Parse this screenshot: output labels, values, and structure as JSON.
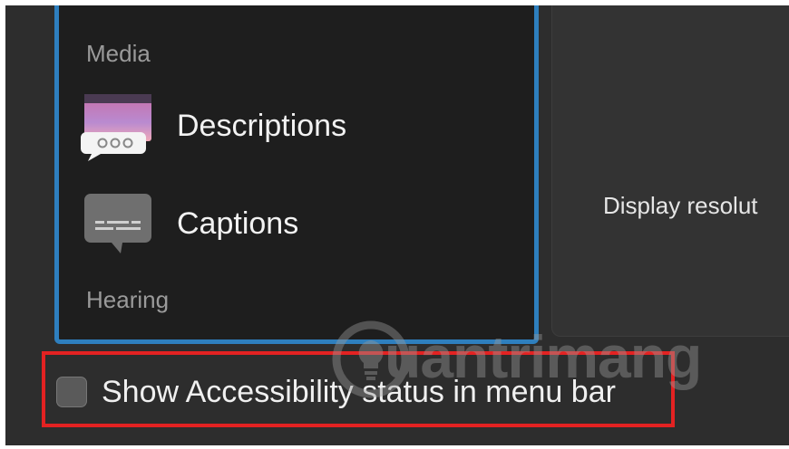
{
  "sidebar": {
    "media_header": "Media",
    "hearing_header": "Hearing",
    "items": [
      {
        "label": "Descriptions",
        "icon": "descriptions-icon"
      },
      {
        "label": "Captions",
        "icon": "captions-icon"
      }
    ]
  },
  "detail": {
    "text": "Display resolut"
  },
  "options": {
    "show_status_label": "Show Accessibility status in menu bar",
    "show_status_checked": false
  },
  "watermark": {
    "text": "uantrimang"
  },
  "colors": {
    "selection_border": "#2e7fbe",
    "highlight_box": "#e32222",
    "sidebar_bg": "#1e1e1e",
    "window_bg": "#2d2d2d"
  }
}
